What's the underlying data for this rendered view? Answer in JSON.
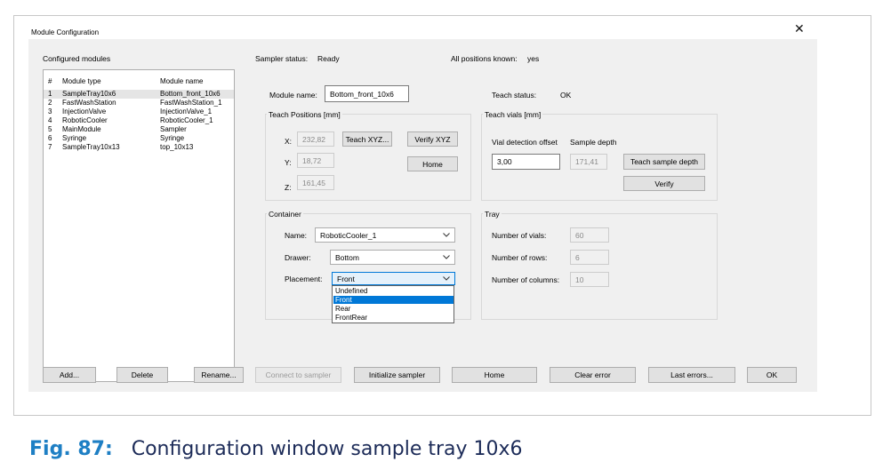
{
  "window": {
    "title": "Module Configuration",
    "close_glyph": "✕"
  },
  "modules": {
    "group_label": "Configured modules",
    "columns": [
      "#",
      "Module type",
      "Module name"
    ],
    "rows": [
      {
        "n": "1",
        "type": "SampleTray10x6",
        "name": "Bottom_front_10x6",
        "selected": true
      },
      {
        "n": "2",
        "type": "FastWashStation",
        "name": "FastWashStation_1"
      },
      {
        "n": "3",
        "type": "InjectionValve",
        "name": "InjectionValve_1"
      },
      {
        "n": "4",
        "type": "RoboticCooler",
        "name": "RoboticCooler_1"
      },
      {
        "n": "5",
        "type": "MainModule",
        "name": "Sampler"
      },
      {
        "n": "6",
        "type": "Syringe",
        "name": "Syringe"
      },
      {
        "n": "7",
        "type": "SampleTray10x13",
        "name": "top_10x13"
      }
    ]
  },
  "status": {
    "sampler_label": "Sampler status:",
    "sampler_value": "Ready",
    "positions_label": "All positions known:",
    "positions_value": "yes"
  },
  "module": {
    "name_label": "Module name:",
    "name_value": "Bottom_front_10x6",
    "teach_status_label": "Teach status:",
    "teach_status_value": "OK"
  },
  "teach_positions": {
    "label": "Teach Positions [mm]",
    "x_label": "X:",
    "x_value": "232,82",
    "y_label": "Y:",
    "y_value": "18,72",
    "z_label": "Z:",
    "z_value": "161,45",
    "teach_xyz": "Teach XYZ...",
    "verify_xyz": "Verify XYZ",
    "home": "Home"
  },
  "teach_vials": {
    "label": "Teach vials [mm]",
    "offset_label": "Vial detection offset",
    "depth_label": "Sample depth",
    "offset_value": "3,00",
    "depth_value": "171,41",
    "teach_depth": "Teach sample depth",
    "verify": "Verify"
  },
  "container": {
    "label": "Container",
    "name_label": "Name:",
    "name_value": "RoboticCooler_1",
    "drawer_label": "Drawer:",
    "drawer_value": "Bottom",
    "placement_label": "Placement:",
    "placement_value": "Front",
    "placement_options": [
      "Undefined",
      "Front",
      "Rear",
      "FrontRear"
    ]
  },
  "tray": {
    "label": "Tray",
    "vials_label": "Number of vials:",
    "vials_value": "60",
    "rows_label": "Number of rows:",
    "rows_value": "6",
    "cols_label": "Number of columns:",
    "cols_value": "10"
  },
  "buttons": {
    "add": "Add...",
    "delete": "Delete",
    "rename": "Rename...",
    "connect": "Connect to sampler",
    "initialize": "Initialize sampler",
    "home": "Home",
    "clear_error": "Clear error",
    "last_errors": "Last errors...",
    "ok": "OK"
  },
  "caption": {
    "number": "Fig. 87:",
    "text": "Configuration window sample tray 10x6"
  },
  "colors": {
    "accent": "#0078d7",
    "caption_number": "#1e7fc4",
    "caption_text": "#1c2b58"
  }
}
